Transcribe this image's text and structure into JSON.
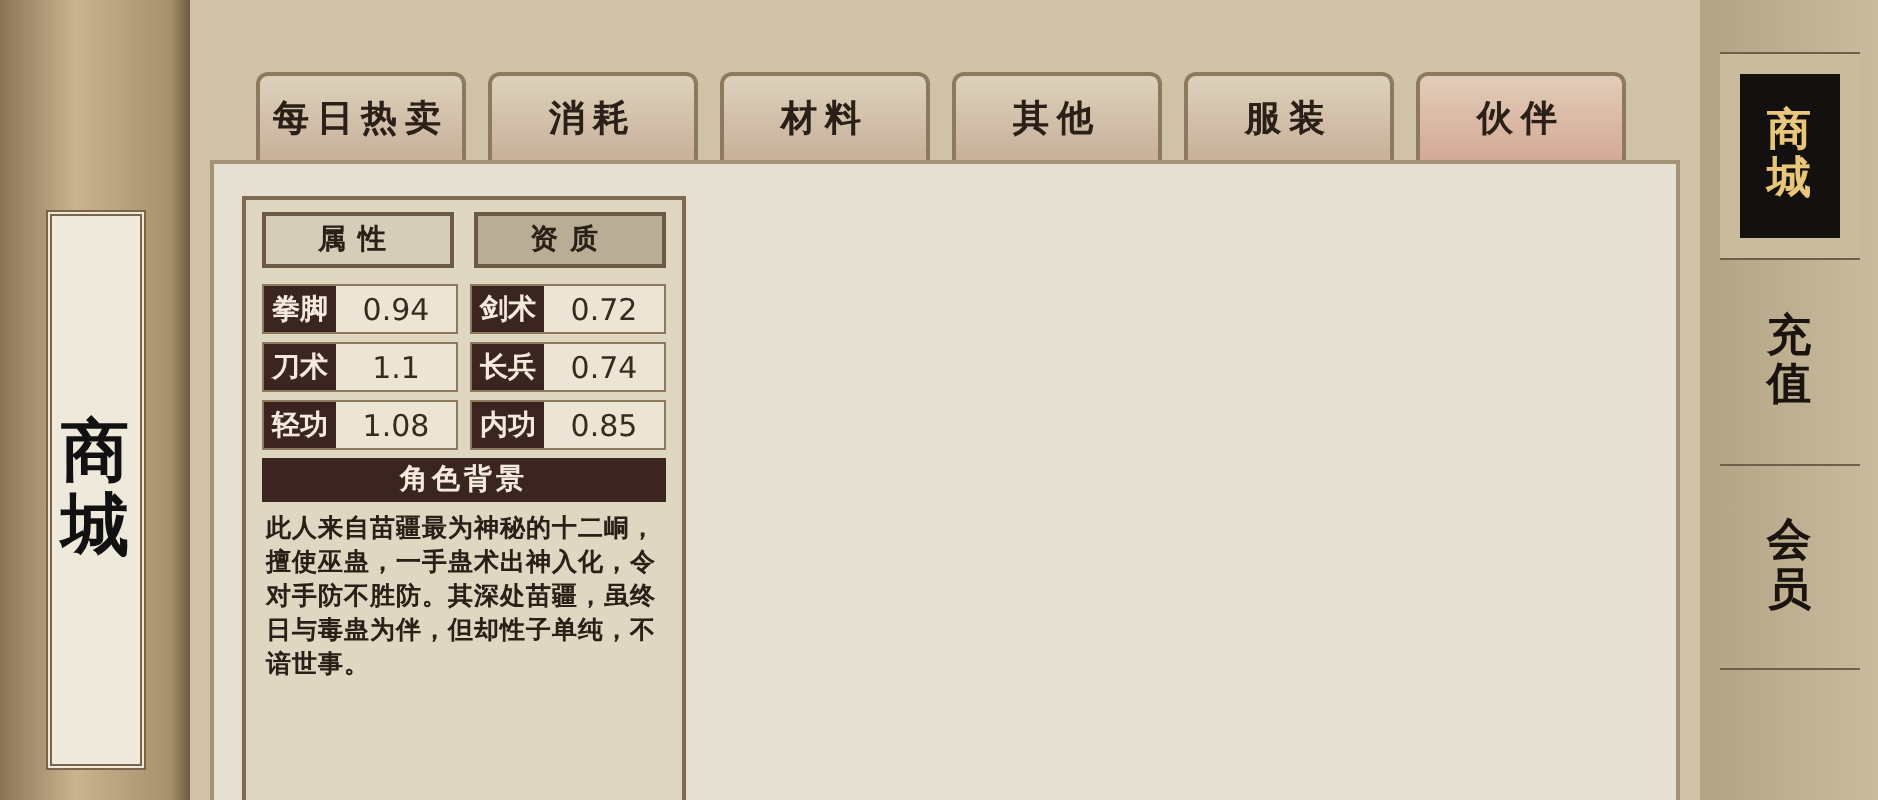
{
  "scroll_label": "商城",
  "tabs": [
    {
      "label": "每日热卖",
      "selected": false
    },
    {
      "label": "消耗",
      "selected": false
    },
    {
      "label": "材料",
      "selected": false
    },
    {
      "label": "其他",
      "selected": false
    },
    {
      "label": "服装",
      "selected": false
    },
    {
      "label": "伙伴",
      "selected": true
    }
  ],
  "character": {
    "subtabs": [
      {
        "label": "属性",
        "selected": false
      },
      {
        "label": "资质",
        "selected": true
      }
    ],
    "stats": [
      {
        "name": "拳脚",
        "value": "0.94"
      },
      {
        "name": "剑术",
        "value": "0.72"
      },
      {
        "name": "刀术",
        "value": "1.1"
      },
      {
        "name": "长兵",
        "value": "0.74"
      },
      {
        "name": "轻功",
        "value": "1.08"
      },
      {
        "name": "内功",
        "value": "0.85"
      }
    ],
    "background_title": "角色背景",
    "background_text": "此人来自苗疆最为神秘的十二峒，擅使巫蛊，一手蛊术出神入化，令对手防不胜防。其深处苗疆，虽终日与毒蛊为伴，但却性子单纯，不谙世事。"
  },
  "side_nav": [
    {
      "label": "商城",
      "selected": true
    },
    {
      "label": "充值",
      "selected": false
    },
    {
      "label": "会员",
      "selected": false
    }
  ]
}
